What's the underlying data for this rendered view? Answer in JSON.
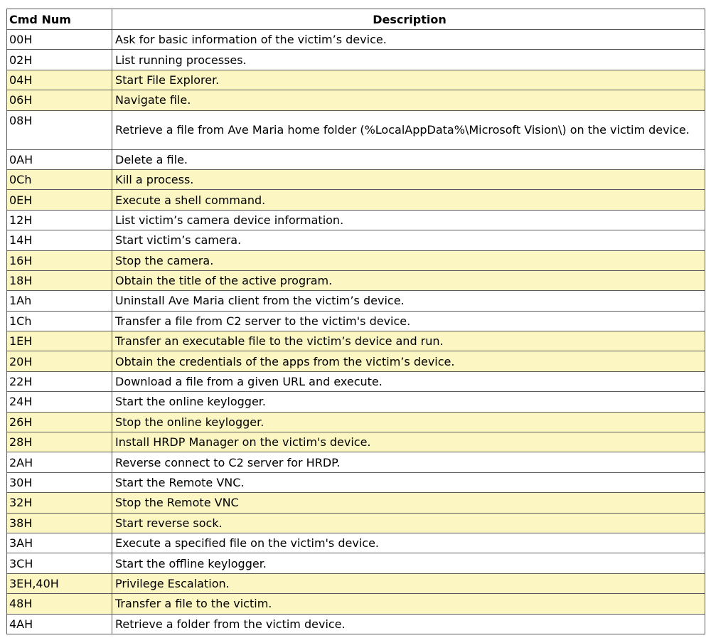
{
  "table": {
    "headers": {
      "cmd": "Cmd Num",
      "description": "Description"
    },
    "highlight_color": "#fcf6c2",
    "rows": [
      {
        "cmd": "00H",
        "desc": "Ask for basic information of the victim’s device.",
        "highlighted": false
      },
      {
        "cmd": "02H",
        "desc": "List running processes.",
        "highlighted": false
      },
      {
        "cmd": "04H",
        "desc": "Start File Explorer.",
        "highlighted": true
      },
      {
        "cmd": "06H",
        "desc": "Navigate file.",
        "highlighted": true
      },
      {
        "cmd": "08H",
        "desc": "Retrieve a file from Ave Maria home folder (%LocalAppData%\\Microsoft Vision\\) on the victim device.",
        "highlighted": false,
        "multiline": true
      },
      {
        "cmd": "0AH",
        "desc": "Delete a file.",
        "highlighted": false
      },
      {
        "cmd": "0Ch",
        "desc": "Kill a process.",
        "highlighted": true
      },
      {
        "cmd": "0EH",
        "desc": "Execute a shell command.",
        "highlighted": true
      },
      {
        "cmd": "12H",
        "desc": "List victim’s camera device information.",
        "highlighted": false
      },
      {
        "cmd": "14H",
        "desc": "Start victim’s camera.",
        "highlighted": false
      },
      {
        "cmd": "16H",
        "desc": "Stop the camera.",
        "highlighted": true
      },
      {
        "cmd": "18H",
        "desc": "Obtain the title of the active program.",
        "highlighted": true
      },
      {
        "cmd": "1Ah",
        "desc": "Uninstall Ave Maria client from the victim’s device.",
        "highlighted": false
      },
      {
        "cmd": "1Ch",
        "desc": "Transfer a file from C2 server to the victim's device.",
        "highlighted": false
      },
      {
        "cmd": "1EH",
        "desc": "Transfer an executable file to the victim’s device and run.",
        "highlighted": true
      },
      {
        "cmd": "20H",
        "desc": "Obtain the credentials of the apps from the victim’s device.",
        "highlighted": true
      },
      {
        "cmd": "22H",
        "desc": "Download a file from a given URL and execute.",
        "highlighted": false
      },
      {
        "cmd": "24H",
        "desc": "Start the online keylogger.",
        "highlighted": false
      },
      {
        "cmd": "26H",
        "desc": "Stop the online keylogger.",
        "highlighted": true
      },
      {
        "cmd": "28H",
        "desc": "Install HRDP Manager on the victim's device.",
        "highlighted": true
      },
      {
        "cmd": "2AH",
        "desc": "Reverse connect to C2 server for HRDP.",
        "highlighted": false
      },
      {
        "cmd": "30H",
        "desc": "Start the Remote VNC.",
        "highlighted": false
      },
      {
        "cmd": "32H",
        "desc": "Stop the Remote VNC",
        "highlighted": true
      },
      {
        "cmd": "38H",
        "desc": "Start reverse sock.",
        "highlighted": true
      },
      {
        "cmd": "3AH",
        "desc": "Execute a specified file on the victim's device.",
        "highlighted": false
      },
      {
        "cmd": "3CH",
        "desc": "Start the offline keylogger.",
        "highlighted": false
      },
      {
        "cmd": "3EH,40H",
        "desc": "Privilege Escalation.",
        "highlighted": true
      },
      {
        "cmd": "48H",
        "desc": "Transfer a file to the victim.",
        "highlighted": true
      },
      {
        "cmd": "4AH",
        "desc": "Retrieve a folder from the victim device.",
        "highlighted": false
      }
    ]
  }
}
